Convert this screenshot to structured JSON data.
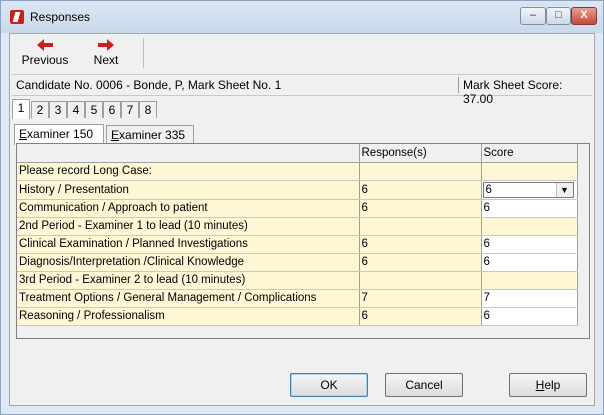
{
  "window": {
    "title": "Responses",
    "controls": {
      "minimize": "–",
      "maximize": "□",
      "close": "X"
    }
  },
  "toolbar": {
    "previous_label": "Previous",
    "next_label": "Next"
  },
  "info": {
    "candidate": "Candidate No. 0006 - Bonde, P,  Mark Sheet No. 1",
    "mark_sheet_score": "Mark Sheet Score:  37.00"
  },
  "page_tabs": [
    "1",
    "2",
    "3",
    "4",
    "5",
    "6",
    "7",
    "8"
  ],
  "examiner_tabs": [
    {
      "prefix": "E",
      "rest": "xaminer 150"
    },
    {
      "prefix": "E",
      "rest": "xaminer 335"
    }
  ],
  "grid": {
    "headers": [
      "",
      "Response(s)",
      "Score"
    ],
    "rows": [
      {
        "label": "Please record Long Case:",
        "response": "",
        "score": ""
      },
      {
        "label": "History / Presentation",
        "response": "6",
        "score": "6"
      },
      {
        "label": "Communication / Approach to patient",
        "response": "6",
        "score": "6"
      },
      {
        "label": "2nd Period - Examiner 1 to lead (10 minutes)",
        "response": "",
        "score": ""
      },
      {
        "label": "Clinical Examination / Planned Investigations",
        "response": "6",
        "score": "6"
      },
      {
        "label": "Diagnosis/Interpretation /Clinical Knowledge",
        "response": "6",
        "score": "6"
      },
      {
        "label": "3rd Period - Examiner 2 to lead (10 minutes)",
        "response": "",
        "score": ""
      },
      {
        "label": "Treatment Options / General Management / Complications",
        "response": "7",
        "score": "7"
      },
      {
        "label": "Reasoning / Professionalism",
        "response": "6",
        "score": "6"
      }
    ]
  },
  "buttons": {
    "ok": "OK",
    "cancel": "Cancel",
    "help_prefix": "H",
    "help_rest": "elp"
  },
  "colors": {
    "row_bg": "#fdf7d5",
    "accent_red": "#c8201f"
  }
}
